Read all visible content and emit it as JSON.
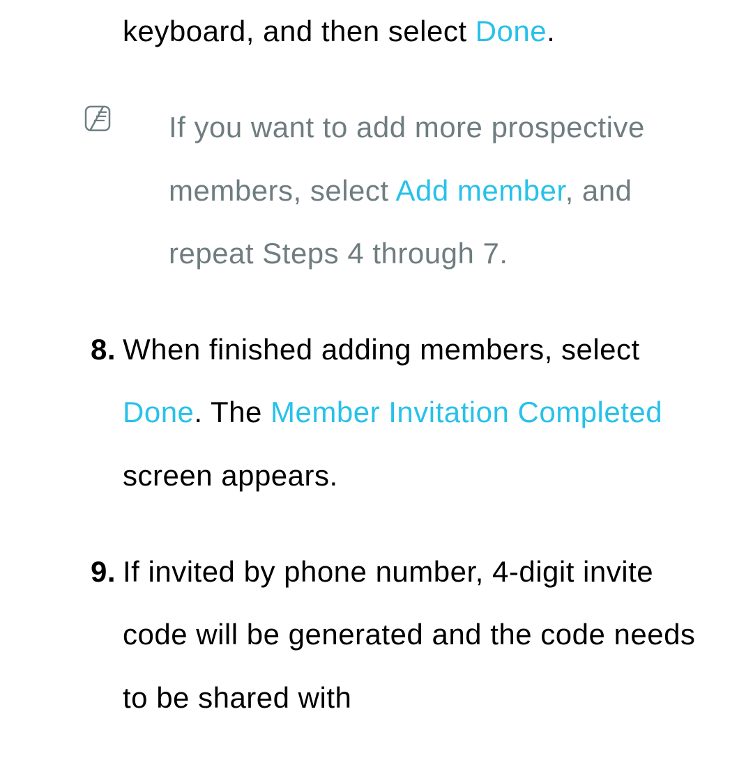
{
  "colors": {
    "term": "#27c1ea",
    "muted": "#6f7d81",
    "text": "#000000"
  },
  "frag": {
    "pre": "keyboard, and then select ",
    "term": "Done",
    "post": "."
  },
  "note": {
    "pre1": "If you want to add more prospective members, select ",
    "term1": "Add member",
    "post1": ", and repeat Steps 4 through 7."
  },
  "step8": {
    "num": "8.",
    "pre1": "When finished adding members, select ",
    "term1": "Done",
    "mid1": ". The ",
    "term2": "Member Invitation Completed",
    "post1": " screen appears."
  },
  "step9": {
    "num": "9.",
    "text": "If invited by phone number, 4-digit invite code will be generated and the code needs to be shared with"
  }
}
